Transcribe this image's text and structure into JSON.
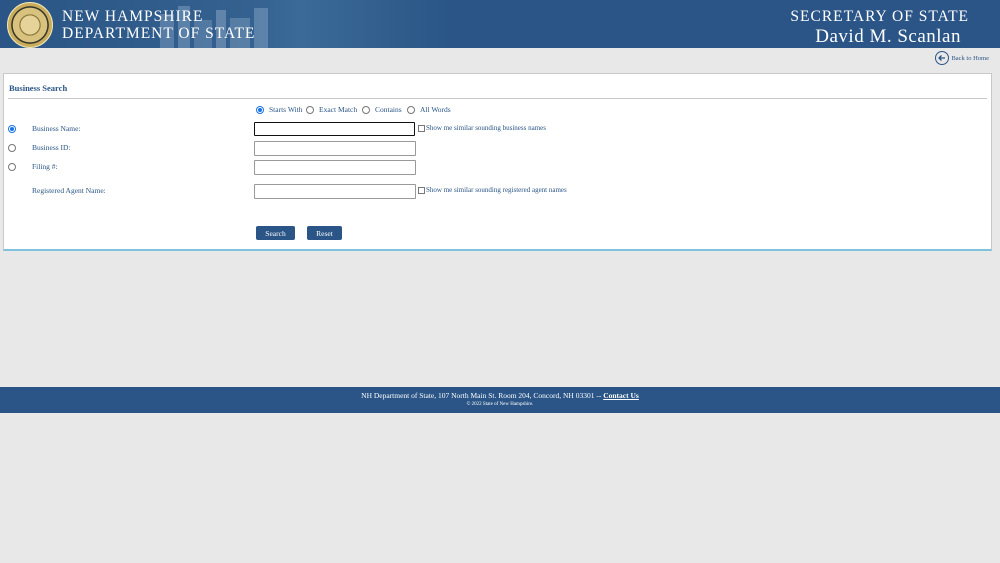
{
  "header": {
    "dept_line1": "NEW HAMPSHIRE",
    "dept_line2": "DEPARTMENT OF STATE",
    "office_title": "SECRETARY OF STATE",
    "officer_name": "David M. Scanlan",
    "seal_icon": "state-seal-icon"
  },
  "nav": {
    "back_label": "Back to Home",
    "back_icon": "arrow-left-circle-icon"
  },
  "search": {
    "title": "Business Search",
    "match_modes": [
      {
        "label": "Starts With",
        "selected": true
      },
      {
        "label": "Exact Match",
        "selected": false
      },
      {
        "label": "Contains",
        "selected": false
      },
      {
        "label": "All Words",
        "selected": false
      }
    ],
    "fields": {
      "business_name": {
        "label": "Business Name:",
        "value": "",
        "selected": true
      },
      "business_id": {
        "label": "Business ID:",
        "value": "",
        "selected": false
      },
      "filing_number": {
        "label": "Filing #:",
        "value": "",
        "selected": false
      },
      "agent_name": {
        "label": "Registered Agent Name:",
        "value": ""
      }
    },
    "similar_business_label": "Show me similar sounding business names",
    "similar_agent_label": "Show me similar sounding registered agent names",
    "search_button": "Search",
    "reset_button": "Reset"
  },
  "footer": {
    "address": "NH Department of State, 107 North Main St. Room 204, Concord, NH 03301 -- ",
    "contact_label": "Contact Us",
    "copyright": "© 2022 State of New Hampshire."
  },
  "colors": {
    "brand_blue": "#2a5586",
    "accent_line": "#7fc2de",
    "radio_selected": "#1a73e8"
  }
}
